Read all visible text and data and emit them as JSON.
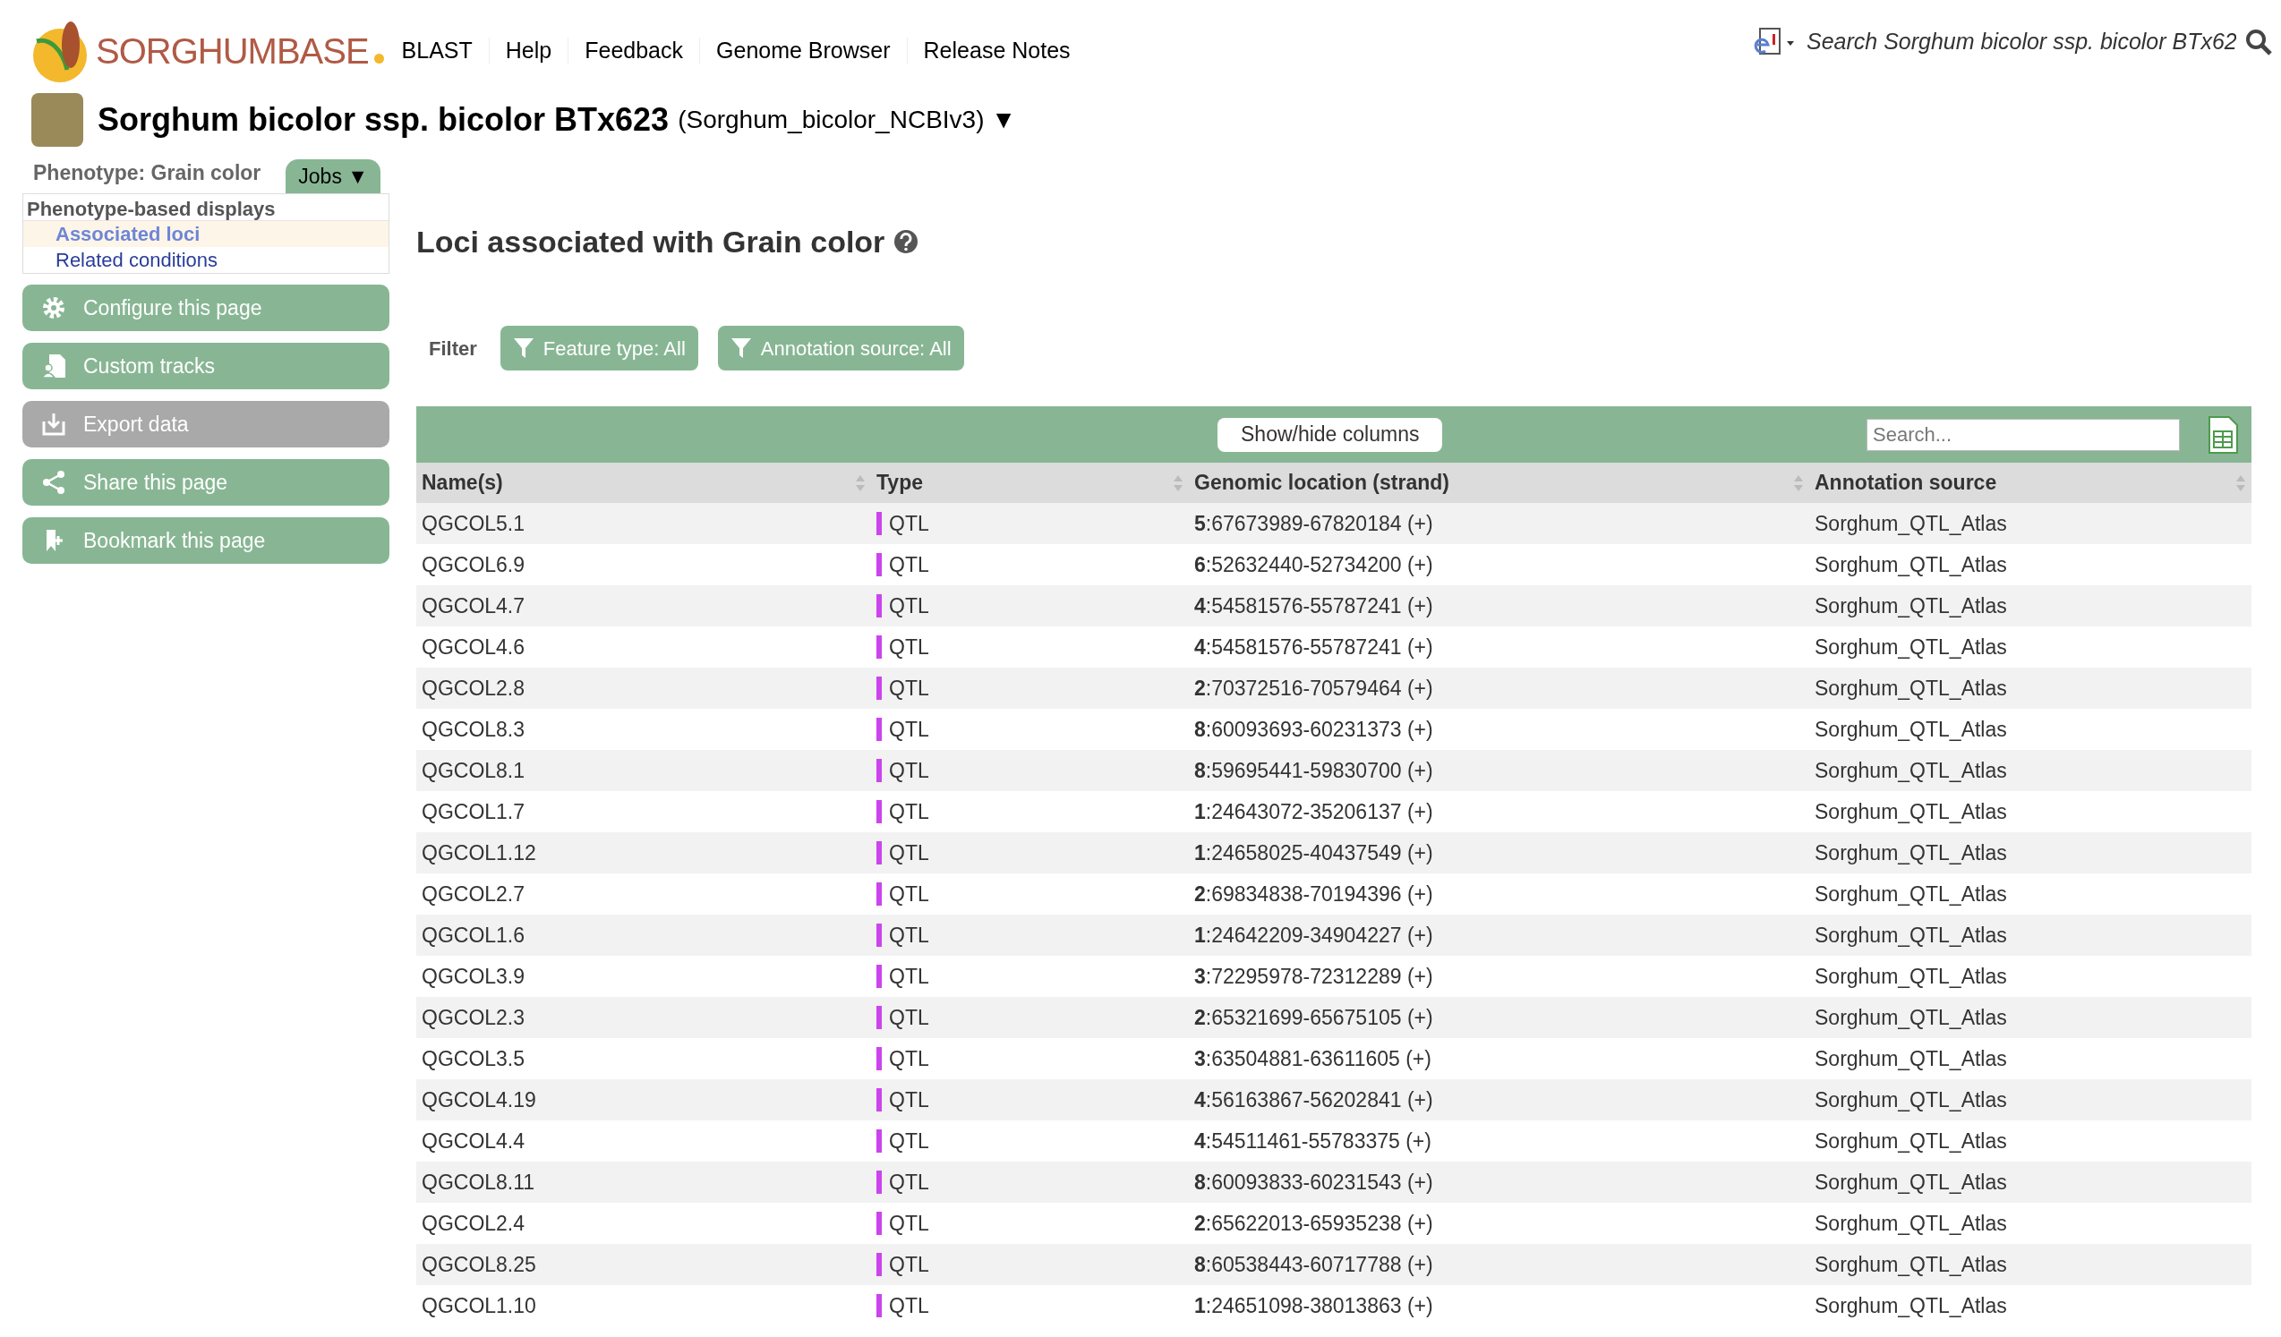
{
  "header": {
    "logo": "SORGHUMBASE",
    "nav": [
      "BLAST",
      "Help",
      "Feedback",
      "Genome Browser",
      "Release Notes"
    ],
    "search": {
      "placeholder": "Search Sorghum bicolor ssp. bicolor BTx62"
    }
  },
  "species": {
    "name": "Sorghum bicolor ssp. bicolor BTx623",
    "assembly": "(Sorghum_bicolor_NCBIv3)",
    "caret": "▼"
  },
  "sidebar": {
    "phenotype": "Phenotype: Grain color",
    "jobs": {
      "label": "Jobs",
      "caret": "▼"
    },
    "displays_title": "Phenotype-based displays",
    "items": [
      {
        "label": "Associated loci",
        "selected": true
      },
      {
        "label": "Related conditions",
        "selected": false
      }
    ],
    "buttons": [
      {
        "label": "Configure this page",
        "kind": "gear",
        "disabled": false
      },
      {
        "label": "Custom tracks",
        "kind": "tracks",
        "disabled": false
      },
      {
        "label": "Export data",
        "kind": "export",
        "disabled": true
      },
      {
        "label": "Share this page",
        "kind": "share",
        "disabled": false
      },
      {
        "label": "Bookmark this page",
        "kind": "bookmark",
        "disabled": false
      }
    ]
  },
  "main": {
    "title": "Loci associated with Grain color",
    "filter_label": "Filter",
    "filters": [
      "Feature type: All",
      "Annotation source: All"
    ],
    "toolbar": {
      "columns_button": "Show/hide columns",
      "search": {
        "placeholder": "Search..."
      }
    },
    "table": {
      "columns": [
        "Name(s)",
        "Type",
        "Genomic location (strand)",
        "Annotation source"
      ],
      "rows": [
        [
          "QGCOL5.1",
          "QTL",
          "**5**:67673989-67820184 (+)",
          "Sorghum_QTL_Atlas"
        ],
        [
          "QGCOL6.9",
          "QTL",
          "**6**:52632440-52734200 (+)",
          "Sorghum_QTL_Atlas"
        ],
        [
          "QGCOL4.7",
          "QTL",
          "**4**:54581576-55787241 (+)",
          "Sorghum_QTL_Atlas"
        ],
        [
          "QGCOL4.6",
          "QTL",
          "**4**:54581576-55787241 (+)",
          "Sorghum_QTL_Atlas"
        ],
        [
          "QGCOL2.8",
          "QTL",
          "**2**:70372516-70579464 (+)",
          "Sorghum_QTL_Atlas"
        ],
        [
          "QGCOL8.3",
          "QTL",
          "**8**:60093693-60231373 (+)",
          "Sorghum_QTL_Atlas"
        ],
        [
          "QGCOL8.1",
          "QTL",
          "**8**:59695441-59830700 (+)",
          "Sorghum_QTL_Atlas"
        ],
        [
          "QGCOL1.7",
          "QTL",
          "**1**:24643072-35206137 (+)",
          "Sorghum_QTL_Atlas"
        ],
        [
          "QGCOL1.12",
          "QTL",
          "**1**:24658025-40437549 (+)",
          "Sorghum_QTL_Atlas"
        ],
        [
          "QGCOL2.7",
          "QTL",
          "**2**:69834838-70194396 (+)",
          "Sorghum_QTL_Atlas"
        ],
        [
          "QGCOL1.6",
          "QTL",
          "**1**:24642209-34904227 (+)",
          "Sorghum_QTL_Atlas"
        ],
        [
          "QGCOL3.9",
          "QTL",
          "**3**:72295978-72312289 (+)",
          "Sorghum_QTL_Atlas"
        ],
        [
          "QGCOL2.3",
          "QTL",
          "**2**:65321699-65675105 (+)",
          "Sorghum_QTL_Atlas"
        ],
        [
          "QGCOL3.5",
          "QTL",
          "**3**:63504881-63611605 (+)",
          "Sorghum_QTL_Atlas"
        ],
        [
          "QGCOL4.19",
          "QTL",
          "**4**:56163867-56202841 (+)",
          "Sorghum_QTL_Atlas"
        ],
        [
          "QGCOL4.4",
          "QTL",
          "**4**:54511461-55783375 (+)",
          "Sorghum_QTL_Atlas"
        ],
        [
          "QGCOL8.11",
          "QTL",
          "**8**:60093833-60231543 (+)",
          "Sorghum_QTL_Atlas"
        ],
        [
          "QGCOL2.4",
          "QTL",
          "**2**:65622013-65935238 (+)",
          "Sorghum_QTL_Atlas"
        ],
        [
          "QGCOL8.25",
          "QTL",
          "**8**:60538443-60717788 (+)",
          "Sorghum_QTL_Atlas"
        ],
        [
          "QGCOL1.10",
          "QTL",
          "**1**:24651098-38013863 (+)",
          "Sorghum_QTL_Atlas"
        ]
      ]
    }
  }
}
